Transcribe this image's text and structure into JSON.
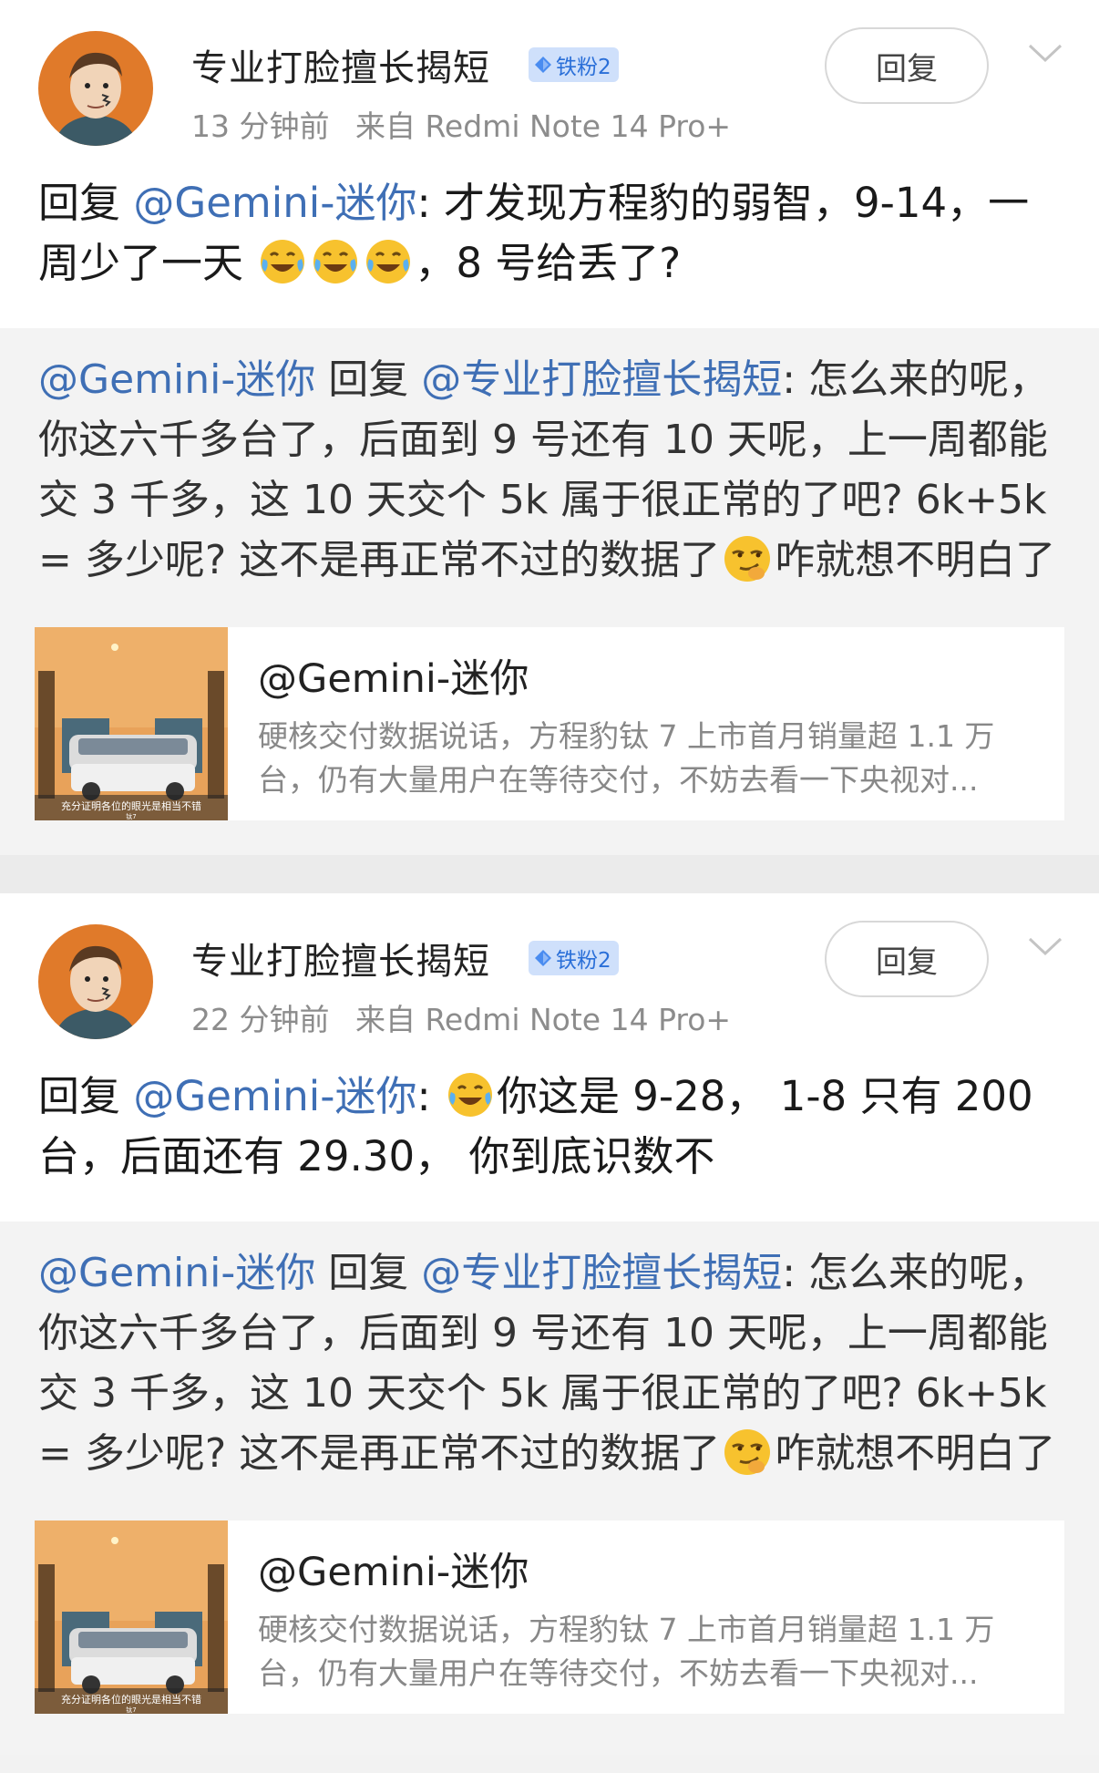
{
  "posts": [
    {
      "username": "专业打脸擅长揭短",
      "fan_badge": "铁粉2",
      "time": "13 分钟前",
      "source": "来自 Redmi Note 14 Pro+",
      "reply_button": "回复",
      "reply_prefix": "回复",
      "mention": "@Gemini-迷你",
      "text_a": ": 才发现方程豹的弱智，9-14，一周少了一天",
      "text_b": "，8 号给丢了?",
      "quote": {
        "mention_from": "@Gemini-迷你",
        "reply_word": "回复",
        "mention_to": "@专业打脸擅长揭短",
        "text_a": ": 怎么来的呢，你这六千多台了，后面到 9 号还有 10 天呢，上一周都能交 3 千多，这 10 天交个 5k 属于很正常的了吧? 6k+5k = 多少呢? 这不是再正常不过的数据了",
        "text_b": "咋就想不明白了"
      },
      "card": {
        "title": "@Gemini-迷你",
        "desc": "硬核交付数据说话，方程豹钛 7 上市首月销量超 1.1 万台，仍有大量用户在等待交付，不妨去看一下央视对...",
        "thumb_caption": "充分证明各位的眼光是相当不错",
        "thumb_sub": "钛7"
      }
    },
    {
      "username": "专业打脸擅长揭短",
      "fan_badge": "铁粉2",
      "time": "22 分钟前",
      "source": "来自 Redmi Note 14 Pro+",
      "reply_button": "回复",
      "reply_prefix": "回复",
      "mention": "@Gemini-迷你",
      "text_a": ": ",
      "text_b": "你这是 9-28，   1-8 只有 200 台，后面还有 29.30，  你到底识数不",
      "quote": {
        "mention_from": "@Gemini-迷你",
        "reply_word": "回复",
        "mention_to": "@专业打脸擅长揭短",
        "text_a": ": 怎么来的呢，你这六千多台了，后面到 9 号还有 10 天呢，上一周都能交 3 千多，这 10 天交个 5k 属于很正常的了吧? 6k+5k = 多少呢? 这不是再正常不过的数据了",
        "text_b": "咋就想不明白了"
      },
      "card": {
        "title": "@Gemini-迷你",
        "desc": "硬核交付数据说话，方程豹钛 7 上市首月销量超 1.1 万台，仍有大量用户在等待交付，不妨去看一下央视对...",
        "thumb_caption": "充分证明各位的眼光是相当不错",
        "thumb_sub": "钛7"
      }
    }
  ],
  "icons": {
    "emoji_laugh_cry": "laugh-cry-emoji-icon",
    "emoji_smirk": "smirk-emoji-icon",
    "chevron": "chevron-down-icon",
    "badge_diamond": "diamond-icon"
  },
  "colors": {
    "mention": "#3f6fb5",
    "badge_bg": "#cfe0fb",
    "badge_text": "#2a6fd8",
    "meta_gray": "#8c8c8c"
  }
}
